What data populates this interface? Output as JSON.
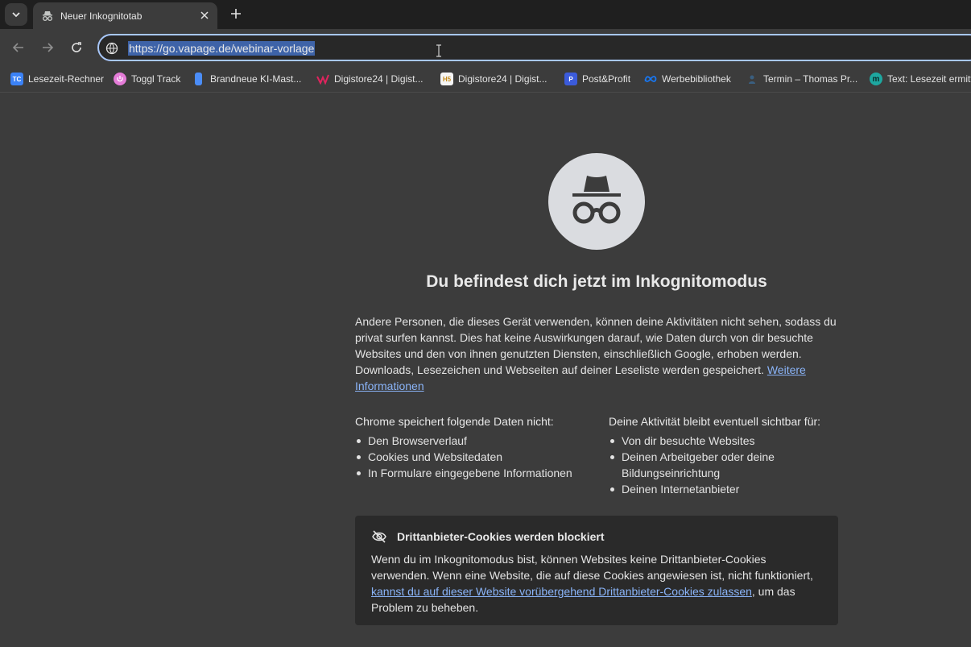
{
  "tab": {
    "title": "Neuer Inkognitotab"
  },
  "omnibox": {
    "url": "https://go.vapage.de/webinar-vorlage"
  },
  "bookmarks": [
    {
      "label": "Lesezeit-Rechner",
      "icon": "tc-icon",
      "color": "#3b82f6",
      "glyph": "TC"
    },
    {
      "label": "Toggl Track",
      "icon": "toggl-icon",
      "color": "#e57cd8",
      "glyph": ""
    },
    {
      "label": "Brandneue KI-Mast...",
      "icon": "doc-icon",
      "color": "#4b8df8",
      "glyph": ""
    },
    {
      "label": "Digistore24 | Digist...",
      "icon": "digistore-icon",
      "color": "#e0245e",
      "glyph": ""
    },
    {
      "label": "Digistore24 | Digist...",
      "icon": "h5-icon",
      "color": "#f5f5f5",
      "glyph": "H5"
    },
    {
      "label": "Post&Profit",
      "icon": "postprofit-icon",
      "color": "#3b5bdb",
      "glyph": ""
    },
    {
      "label": "Werbebibliothek",
      "icon": "meta-icon",
      "color": "#1877f2",
      "glyph": ""
    },
    {
      "label": "Termin – Thomas Pr...",
      "icon": "termin-icon",
      "color": "#2f4f6f",
      "glyph": ""
    },
    {
      "label": "Text: Lesezeit ermitt",
      "icon": "m-icon",
      "color": "#1ea7a0",
      "glyph": "m"
    }
  ],
  "content": {
    "heading": "Du befindest dich jetzt im Inkognitomodus",
    "intro_text": "Andere Personen, die dieses Gerät verwenden, können deine Aktivitäten nicht sehen, sodass du privat surfen kannst. Dies hat keine Auswirkungen darauf, wie Daten durch von dir besuchte Websites und den von ihnen genutzten Diensten, einschließlich Google, erhoben werden. Downloads, Lesezeichen und Webseiten auf deiner Leseliste werden gespeichert.",
    "intro_link": "Weitere Informationen",
    "left_heading": "Chrome speichert folgende Daten nicht:",
    "left_items": [
      "Den Browserverlauf",
      "Cookies und Websitedaten",
      "In Formulare eingegebene Informationen"
    ],
    "right_heading": "Deine Aktivität bleibt eventuell sichtbar für:",
    "right_items": [
      "Von dir besuchte Websites",
      "Deinen Arbeitgeber oder deine Bildungseinrichtung",
      "Deinen Internetanbieter"
    ]
  },
  "cookie_card": {
    "title": "Drittanbieter-Cookies werden blockiert",
    "text_before": "Wenn du im Inkognitomodus bist, können Websites keine Drittanbieter-Cookies verwenden. Wenn eine Website, die auf diese Cookies angewiesen ist, nicht funktioniert,",
    "link": "kannst du auf dieser Website vorübergehend Drittanbieter-Cookies zulassen",
    "text_after": ", um das Problem zu beheben."
  },
  "colors": {
    "accent": "#a8c7fa",
    "link": "#8ab4f8",
    "background": "#3c3c3c"
  }
}
